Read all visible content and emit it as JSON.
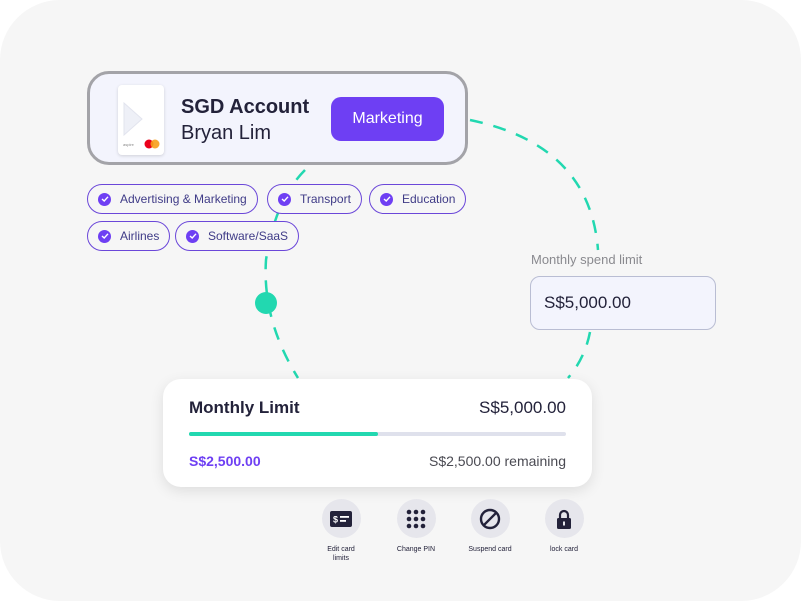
{
  "account": {
    "title": "SGD Account",
    "holder": "Bryan Lim",
    "team_button": "Marketing",
    "card_brand_text": "aspire"
  },
  "categories": [
    "Advertising & Marketing",
    "Transport",
    "Education",
    "Airlines",
    "Software/SaaS"
  ],
  "spend_limit": {
    "label": "Monthly spend limit",
    "value": "S$5,000.00"
  },
  "monthly_limit": {
    "title": "Monthly Limit",
    "total": "S$5,000.00",
    "spent": "S$2,500.00",
    "remaining": "S$2,500.00 remaining",
    "progress_fraction": 0.5
  },
  "actions": [
    {
      "label": "Edit card limits",
      "icon": "edit-card-icon"
    },
    {
      "label": "Change PIN",
      "icon": "keypad-icon"
    },
    {
      "label": "Suspend card",
      "icon": "suspend-icon"
    },
    {
      "label": "lock card",
      "icon": "lock-icon"
    }
  ],
  "colors": {
    "accent": "#6e3ff3",
    "progress": "#22d8b0",
    "connector": "#22d8b0"
  }
}
